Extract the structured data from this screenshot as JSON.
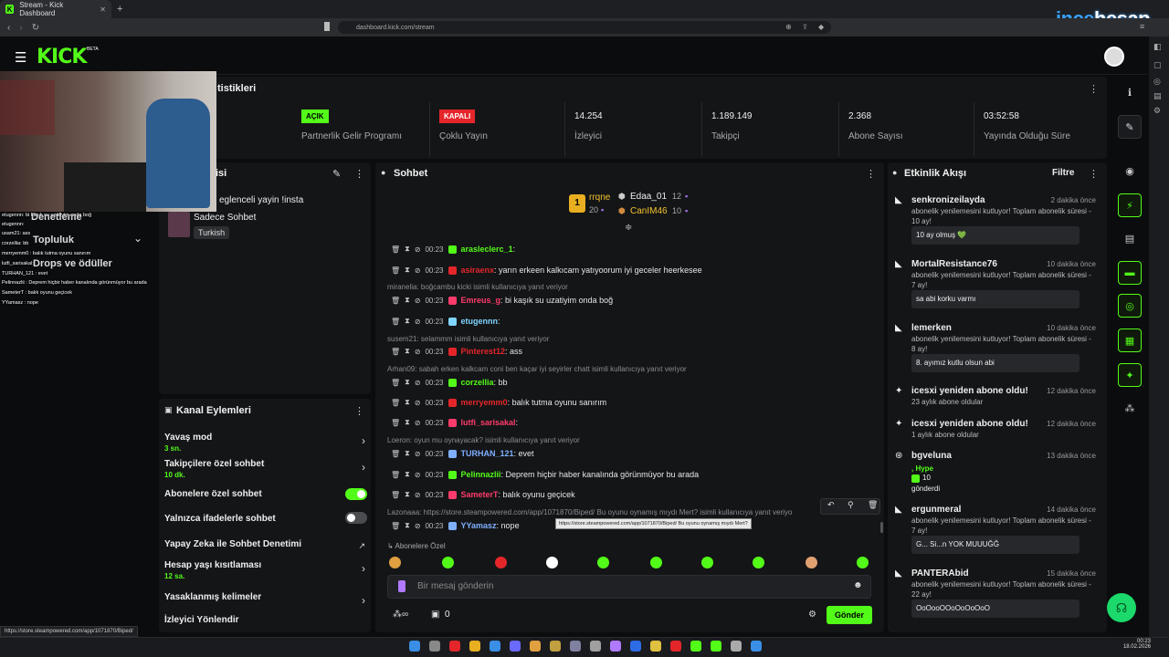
{
  "browser": {
    "tab_title": "Stream - Kick Dashboard",
    "url": "dashboard.kick.com/stream",
    "status_url": "https://store.steampowered.com/app/1071870/Biped/"
  },
  "watermark": {
    "a": "ince",
    "b": "hesap",
    "c": ".com"
  },
  "header": {
    "logo": "KICK",
    "beta": "BETA"
  },
  "stats": {
    "title_partial": "tistikleri",
    "items": [
      {
        "badge": "AÇIK",
        "label": "Partnerlik Gelir Programı"
      },
      {
        "badge": "KAPALI",
        "label": "Çoklu Yayın"
      },
      {
        "value": "14.254",
        "label": "İzleyici"
      },
      {
        "value": "1.189.149",
        "label": "Takipçi"
      },
      {
        "value": "2.368",
        "label": "Abone Sayısı"
      },
      {
        "value": "03:52:58",
        "label": "Yayında Olduğu Süre"
      }
    ]
  },
  "stream_info": {
    "title_partial": "isi",
    "stream_title": "eglenceli yayin !insta",
    "category": "Sadece Sohbet",
    "tag": "Turkish"
  },
  "left_overlay": {
    "menu": [
      "Denetleme",
      "Topluluk",
      "Drops ve ödüller"
    ],
    "chat_lines": [
      "etugennn: bi kaşık su uzatiyim onda boğ",
      "etugennn:",
      "usam21: ass",
      "corzellia: bb",
      "merryemm0 : balık tutma oyunu sanırım",
      "lutfi_sarisakal:",
      "TURHAN_121 : evet",
      "Pelinnazlii : Deprem hiçbir haber kanalında görünmüyor bu arada",
      "SameterT : balık oyunu geçicek",
      "YYamasz : nope"
    ]
  },
  "channel_actions": {
    "title": "Kanal Eylemleri",
    "items": [
      {
        "label": "Yavaş mod",
        "sub": "3 sn."
      },
      {
        "label": "Takipçilere özel sohbet",
        "sub": "10 dk."
      },
      {
        "label": "Abonelere özel sohbet",
        "toggle": true
      },
      {
        "label": "Yalnızca ifadelerle sohbet",
        "toggle": false
      },
      {
        "label": "Yapay Zeka ile Sohbet Denetimi"
      },
      {
        "label": "Hesap yaşı kısıtlaması",
        "sub": "12 sa."
      },
      {
        "label": "Yasaklanmış kelimeler"
      },
      {
        "label": "İzleyici Yönlendir"
      }
    ]
  },
  "chat": {
    "title": "Sohbet",
    "leaderboard": {
      "first": {
        "name": "rrqne",
        "count": "20"
      },
      "second": {
        "name": "Edaa_01",
        "count": "12"
      },
      "third": {
        "name": "CanIM46",
        "count": "10"
      }
    },
    "messages": [
      {
        "time": "00:23",
        "user": "arasleclerc_1",
        "text": ":",
        "color": "#53fc18"
      },
      {
        "time": "00:23",
        "user": "asiraenx",
        "text": ": yarın erkeen kalkıcam yatıyoorum iyi geceler heerkesee",
        "color": "#e4262b"
      },
      {
        "reply": "miranelia: boğcambu kicki isimli kullanıcıya yanıt veriyor"
      },
      {
        "time": "00:23",
        "user": "Emreus_g",
        "text": ": bi kaşık su uzatiyim onda boğ",
        "color": "#ff3b6b"
      },
      {
        "time": "00:23",
        "user": "etugennn",
        "text": ":",
        "color": "#7fd6ff"
      },
      {
        "reply": "susem21: selammm isimli kullanıcıya yanıt veriyor"
      },
      {
        "time": "00:23",
        "user": "Pinterest12",
        "text": ": ass",
        "color": "#e4262b"
      },
      {
        "reply": "Arhan09: sabah erken kalkcam coni ben kaçar iyi seyirler chatt isimli kullanıcıya yanıt veriyor"
      },
      {
        "time": "00:23",
        "user": "corzellia",
        "text": ": bb",
        "color": "#53fc18"
      },
      {
        "time": "00:23",
        "user": "merryemm0",
        "text": ": balık tutma oyunu sanırım",
        "color": "#e4262b"
      },
      {
        "time": "00:23",
        "user": "lutfi_sarisakal",
        "text": ":",
        "color": "#ff3b6b"
      },
      {
        "reply": "Loeron: oyun mu oynayacak? isimli kullanıcıya yanıt veriyor"
      },
      {
        "time": "00:23",
        "user": "TURHAN_121",
        "text": ": evet",
        "color": "#7fb0ff"
      },
      {
        "time": "00:23",
        "user": "Pelinnazlii",
        "text": ": Deprem hiçbir haber kanalında görünmüyor bu arada",
        "color": "#53fc18"
      },
      {
        "time": "00:23",
        "user": "SameterT",
        "text": ": balık oyunu geçicek",
        "color": "#ff3b6b"
      },
      {
        "reply": "Lazonaaa: https://store.steampowered.com/app/1071870/Biped/ Bu oyunu oynamış mıydı Mert? isimli kullanıcıya yanıt veriyo"
      },
      {
        "time": "00:23",
        "user": "YYamasz",
        "text": ": nope",
        "color": "#7fb0ff"
      }
    ],
    "tooltip": "https://store.steampowered.com/app/1071870/Biped/ Bu oyunu oynamış mıydı Mert?",
    "emote_section": "Abonelere Özel",
    "input_placeholder": "Bir mesaj gönderin",
    "points": "0",
    "send": "Gönder"
  },
  "activity": {
    "title": "Etkinlik Akışı",
    "filter": "Filtre",
    "items": [
      {
        "name": "senkronizeilayda",
        "ago": "2 dakika önce",
        "desc": "abonelik yenilemesini kutluyor! Toplam abonelik süresi - 10 ay!",
        "msg": "10 ay olmuş 💚"
      },
      {
        "name": "MortalResistance76",
        "ago": "10 dakika önce",
        "desc": "abonelik yenilemesini kutluyor! Toplam abonelik süresi - 7 ay!",
        "msg": "sa abi korku varmı"
      },
      {
        "name": "lemerken",
        "ago": "10 dakika önce",
        "desc": "abonelik yenilemesini kutluyor! Toplam abonelik süresi - 8 ay!",
        "msg": "8. ayımız kutlu olsun abi"
      },
      {
        "name": "icesxi yeniden abone oldu!",
        "ago": "12 dakika önce",
        "desc": "23 aylık abone oldular"
      },
      {
        "name": "icesxi yeniden abone oldu!",
        "ago": "12 dakika önce",
        "desc": "1 aylık abone oldular"
      },
      {
        "name": "bgveluna",
        "ago": "13 dakika önce",
        "desc": ", Hype",
        "extra": "10",
        "extra2": "gönderdi"
      },
      {
        "name": "ergunmeral",
        "ago": "14 dakika önce",
        "desc": "abonelik yenilemesini kutluyor! Toplam abonelik süresi - 7 ay!",
        "msg": "G... Si...n YOK MUUUĞĞ"
      },
      {
        "name": "PANTERAbid",
        "ago": "15 dakika önce",
        "desc": "abonelik yenilemesini kutluyor! Toplam abonelik süresi - 22 ay!",
        "msg": "OoOooOOoOoOoOoO"
      }
    ]
  },
  "taskbar": {
    "time": "00:23",
    "date": "18.02.2026"
  },
  "colors": {
    "accent": "#53fc18",
    "danger": "#e4262b",
    "panel": "#141517"
  }
}
